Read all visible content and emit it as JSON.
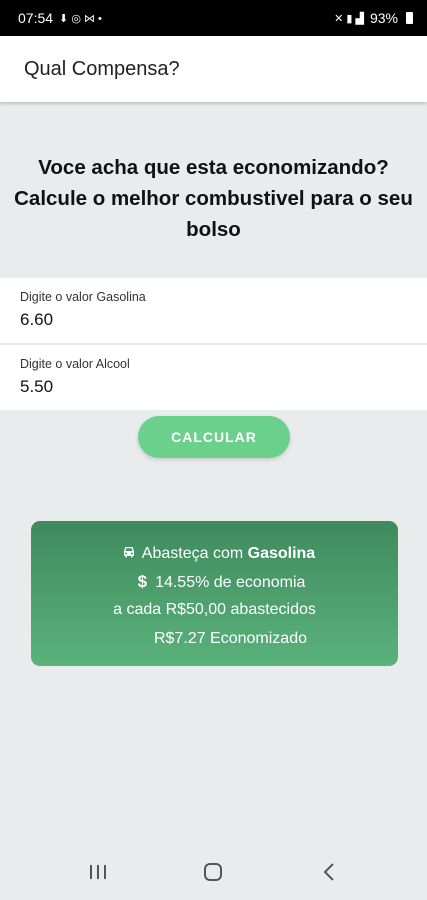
{
  "status_bar": {
    "time": "07:54",
    "battery": "93%"
  },
  "app_bar": {
    "title": "Qual Compensa?"
  },
  "headline": "Voce acha que esta economizando? Calcule o melhor combustivel para o seu bolso",
  "fields": [
    {
      "label": "Digite o valor Gasolina",
      "value": "6.60"
    },
    {
      "label": "Digite o valor Alcool",
      "value": "5.50"
    }
  ],
  "calculate_button": "CALCULAR",
  "result": {
    "prefix": "Abasteça com",
    "fuel": "Gasolina",
    "economy": "14.55% de economia",
    "per_amount": "a cada R$50,00 abastecidos",
    "saved": "R$7.27 Economizado"
  },
  "colors": {
    "accent": "#6cd08d",
    "card_top": "#3f8a5d",
    "card_bottom": "#5ab27b"
  },
  "icons": [
    "car-icon",
    "dollar-icon",
    "recents-icon",
    "home-icon",
    "back-icon"
  ]
}
